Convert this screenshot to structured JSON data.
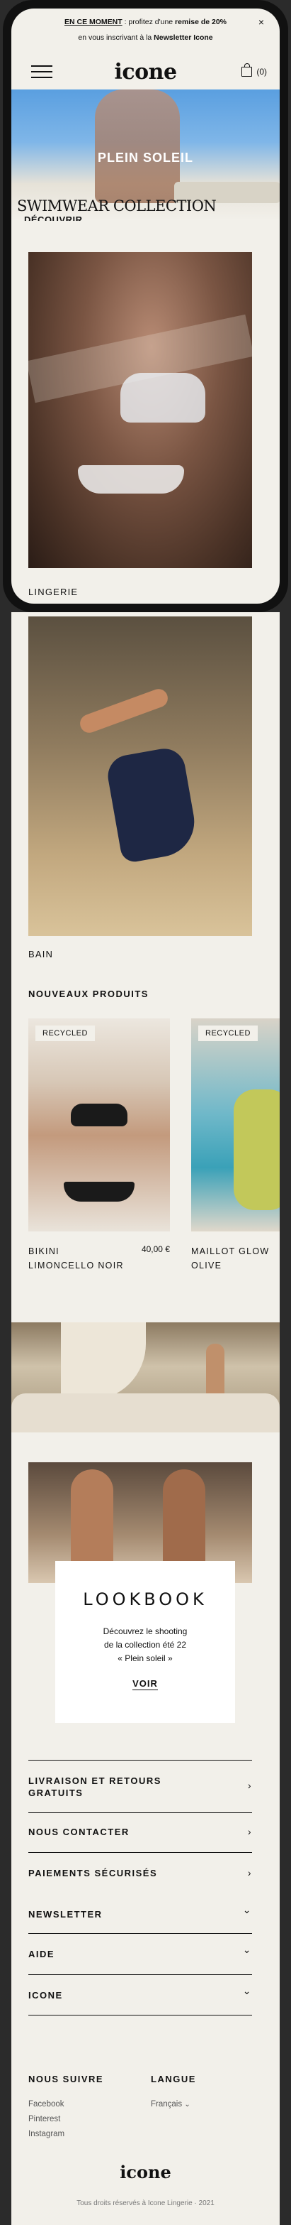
{
  "announcement": {
    "lead": "EN CE MOMENT",
    "text1": " : profitez d'une ",
    "promo": "remise de 20%",
    "text2": "en vous inscrivant à la ",
    "newsletter": "Newsletter Icone",
    "close_icon": "×"
  },
  "header": {
    "logo": "icone",
    "cart_count": "(0)"
  },
  "hero": {
    "brand": "PLEIN SOLEIL",
    "title": "SWIMWEAR COLLECTION",
    "cta": "DÉCOUVRIR"
  },
  "categories": [
    {
      "label": "LINGERIE"
    },
    {
      "label": "BAIN"
    }
  ],
  "new_products": {
    "title": "NOUVEAUX PRODUITS",
    "items": [
      {
        "badge": "RECYCLED",
        "name": "BIKINI LIMONCELLO NOIR",
        "price": "40,00 €"
      },
      {
        "badge": "RECYCLED",
        "name": "MAILLOT GLOW OLIVE",
        "price": ""
      }
    ]
  },
  "lookbook": {
    "title": "LOOKBOOK",
    "line1": "Découvrez le shooting",
    "line2": "de la collection été 22",
    "line3": "« Plein soleil »",
    "cta": "VOIR"
  },
  "info_rows": [
    {
      "label": "LIVRAISON ET RETOURS GRATUITS",
      "icon": "chevron-right-icon",
      "glyph": "›"
    },
    {
      "label": "NOUS CONTACTER",
      "icon": "chevron-right-icon",
      "glyph": "›"
    },
    {
      "label": "PAIEMENTS SÉCURISÉS",
      "icon": "chevron-right-icon",
      "glyph": "›"
    }
  ],
  "accordions": [
    {
      "label": "NEWSLETTER",
      "icon": "chevron-down-icon",
      "glyph": "⌄"
    },
    {
      "label": "AIDE",
      "icon": "chevron-down-icon",
      "glyph": "⌄"
    },
    {
      "label": "ICONE",
      "icon": "chevron-down-icon",
      "glyph": "⌄"
    }
  ],
  "footer": {
    "follow_title": "NOUS SUIVRE",
    "social": [
      "Facebook",
      "Pinterest",
      "Instagram"
    ],
    "language_title": "LANGUE",
    "language_value": "Français",
    "logo": "icone",
    "copyright": "Tous droits réservés à Icone Lingerie · 2021"
  },
  "colors": {
    "background": "#f2f0ea",
    "text": "#111111",
    "frame": "#111111"
  }
}
